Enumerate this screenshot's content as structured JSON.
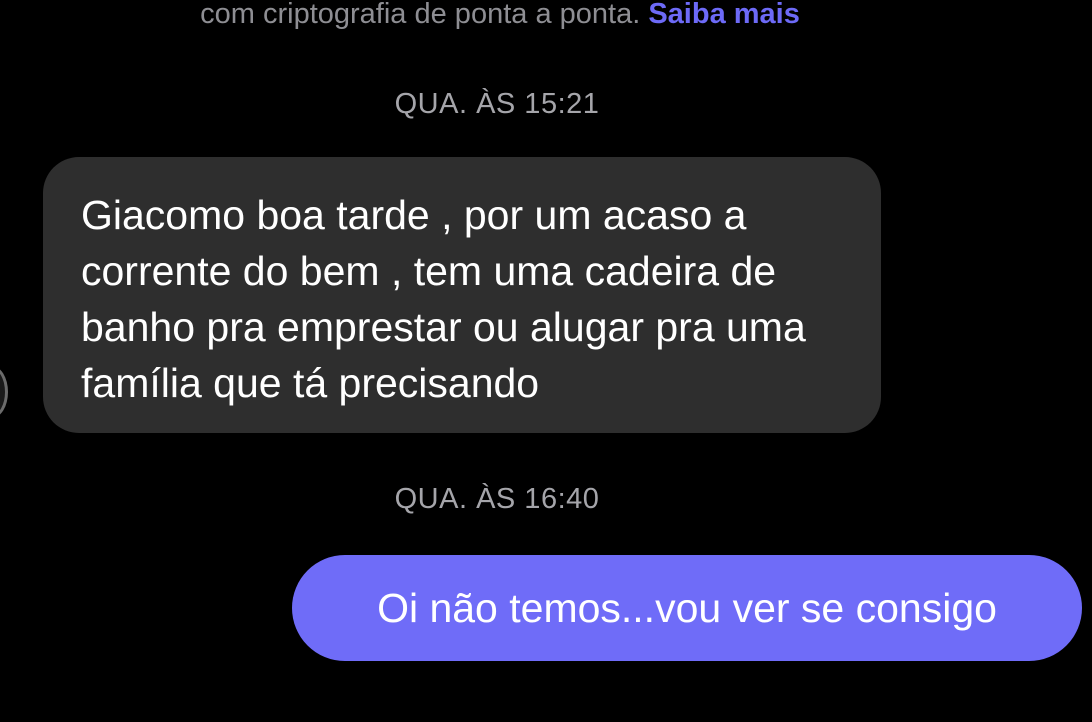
{
  "chat": {
    "encryption_notice": {
      "text": "com criptografia de ponta a ponta.",
      "link": "Saiba mais"
    },
    "messages": [
      {
        "timestamp": "QUA. ÀS 15:21",
        "direction": "incoming",
        "text": "Giacomo boa tarde , por um acaso a corrente do bem , tem uma cadeira de banho pra emprestar ou alugar pra uma família que tá precisando"
      },
      {
        "timestamp": "QUA. ÀS 16:40",
        "direction": "outgoing",
        "text": "Oi não temos...vou ver se consigo"
      }
    ]
  },
  "colors": {
    "background": "#000000",
    "incoming_bubble": "#2e2e2e",
    "outgoing_bubble": "#6f6cf8",
    "link": "#6d6af7",
    "meta_text": "#8e8e93"
  }
}
